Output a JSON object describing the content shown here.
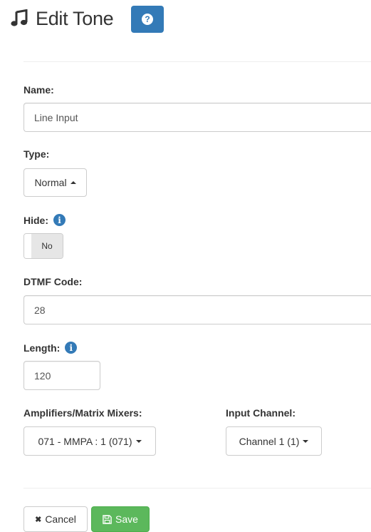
{
  "header": {
    "title": "Edit Tone",
    "title_icon": "music-note-icon",
    "help_button_icon": "question-circle-icon",
    "help_glyph": "?"
  },
  "form": {
    "name": {
      "label": "Name:",
      "value": "Line Input"
    },
    "type": {
      "label": "Type:",
      "value": "Normal"
    },
    "hide": {
      "label": "Hide:",
      "toggle_value": "No",
      "info_icon": "info-circle-icon",
      "info_glyph": "i"
    },
    "dtmf": {
      "label": "DTMF Code:",
      "value": "28"
    },
    "length": {
      "label": "Length:",
      "value": "120",
      "info_icon": "info-circle-icon",
      "info_glyph": "i"
    },
    "amplifiers": {
      "label": "Amplifiers/Matrix Mixers:",
      "value": "071 - MMPA : 1 (071)"
    },
    "input_channel": {
      "label": "Input Channel:",
      "value": "Channel 1 (1)"
    }
  },
  "actions": {
    "cancel_label": "Cancel",
    "cancel_icon": "close-icon",
    "cancel_glyph": "✖",
    "save_label": "Save",
    "save_icon": "floppy-disk-icon"
  },
  "colors": {
    "primary": "#337ab7",
    "success": "#5cb85c",
    "text": "#333333",
    "border": "#cccccc"
  }
}
